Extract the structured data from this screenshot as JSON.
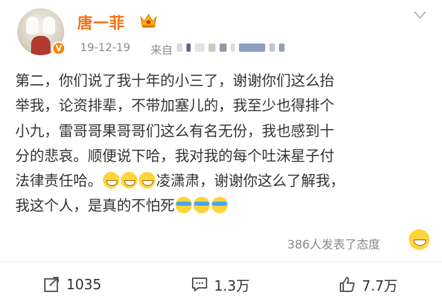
{
  "post": {
    "author": {
      "name": "唐一菲",
      "verified_badge_icon": "verified-v-icon",
      "vip_icon": "crown-icon"
    },
    "timestamp": "19-12-19",
    "source_label": "来自",
    "lines": [
      "第二，你们说了我十年的小三了，谢谢你们这么抬",
      "举我，论资排辈，不带加塞儿的，我至少也得排个",
      "小九，雷哥哥果哥哥们这么有名无份，我也感到十",
      "分的悲哀。顺便说下哈，我对我的每个吐沫星子付",
      "法律责任哈。",
      "凌潇肃，谢谢你这么了解我，",
      "我这个人，是真的不怕死"
    ],
    "reaction_summary": "386人发表了态度"
  },
  "actions": {
    "repost_count": "1035",
    "comment_count": "1.3万",
    "like_count": "7.7万"
  },
  "colors": {
    "username": "#f86d0c",
    "badge": "#ff8200",
    "emoji": "#ffd43b"
  }
}
